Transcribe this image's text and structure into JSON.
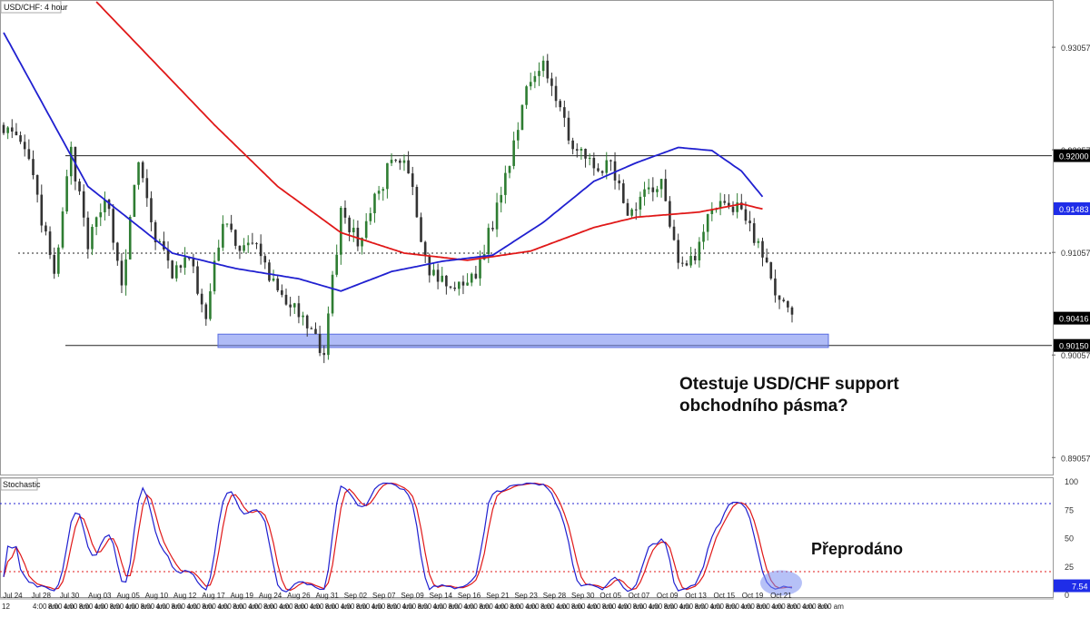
{
  "chart_data": [
    {
      "type": "candlestick",
      "title": "USD/CHF: 4 hour",
      "ylim": [
        0.889,
        0.935
      ],
      "y_ticks": [
        "0.93057",
        "0.92057",
        "0.91057",
        "0.90057",
        "0.89057"
      ],
      "x_ticks": [
        "Jul 24",
        "Jul 28",
        "Jul 30",
        "Aug 03",
        "Aug 05",
        "Aug 10",
        "Aug 12",
        "Aug 17",
        "Aug 19",
        "Aug 24",
        "Aug 26",
        "Aug 31",
        "Sep 02",
        "Sep 07",
        "Sep 09",
        "Sep 14",
        "Sep 16",
        "Sep 21",
        "Sep 23",
        "Sep 28",
        "Sep 30",
        "Oct 05",
        "Oct 07",
        "Oct 09",
        "Oct 13",
        "Oct 15",
        "Oct 19",
        "Oct 21"
      ],
      "x_sublabels": [
        "12",
        "",
        "4:00 am",
        "8:00 am",
        "4:00 am",
        "8:00 am",
        "4:00 am",
        "8:00 am",
        "4:00 am",
        "8:00 am",
        "4:00 am",
        "8:00 am",
        "4:00 am",
        "8:00 am",
        "4:00 am",
        "8:00 am",
        "4:00 am",
        "8:00 am",
        "4:00 am",
        "8:00 am",
        "4:00 am",
        "8:00 am",
        "4:00 am",
        "8:00 am",
        "4:00 am",
        "8:00 am",
        "4:00 am",
        "8:00 am",
        "4:00 am",
        "8:00 am",
        "4:00 am",
        "8:00 am",
        "4:00 am",
        "8:00 am",
        "4:00 am",
        "8:00 am",
        "4:00 am",
        "8:00 am",
        "4:00 am",
        "8:00 am",
        "4:00 am",
        "8:00 am",
        "4:00 am",
        "8:00 am",
        "4:00 am",
        "8:00 am",
        "4:00 am",
        "8:00 am",
        "4:00 am",
        "8:00 am",
        "4:00 am",
        "8:00 am",
        "4:00 am",
        "8:00 am"
      ],
      "price_keypoints": [
        [
          0,
          0.923
        ],
        [
          6,
          0.9195
        ],
        [
          12,
          0.908
        ],
        [
          16,
          0.9205
        ],
        [
          20,
          0.911
        ],
        [
          24,
          0.9165
        ],
        [
          28,
          0.9075
        ],
        [
          32,
          0.9195
        ],
        [
          36,
          0.912
        ],
        [
          40,
          0.9085
        ],
        [
          44,
          0.91
        ],
        [
          48,
          0.904
        ],
        [
          52,
          0.914
        ],
        [
          56,
          0.911
        ],
        [
          60,
          0.911
        ],
        [
          64,
          0.9075
        ],
        [
          68,
          0.9055
        ],
        [
          72,
          0.903
        ],
        [
          76,
          0.901
        ],
        [
          80,
          0.9145
        ],
        [
          84,
          0.9115
        ],
        [
          88,
          0.9155
        ],
        [
          92,
          0.9195
        ],
        [
          96,
          0.9185
        ],
        [
          100,
          0.9095
        ],
        [
          104,
          0.9075
        ],
        [
          108,
          0.907
        ],
        [
          112,
          0.9085
        ],
        [
          116,
          0.9135
        ],
        [
          120,
          0.9195
        ],
        [
          124,
          0.927
        ],
        [
          128,
          0.9295
        ],
        [
          132,
          0.924
        ],
        [
          136,
          0.9205
        ],
        [
          140,
          0.9185
        ],
        [
          144,
          0.919
        ],
        [
          148,
          0.9145
        ],
        [
          152,
          0.9165
        ],
        [
          156,
          0.9175
        ],
        [
          160,
          0.91
        ],
        [
          164,
          0.91
        ],
        [
          168,
          0.915
        ],
        [
          172,
          0.9155
        ],
        [
          176,
          0.914
        ],
        [
          180,
          0.91
        ],
        [
          184,
          0.906
        ],
        [
          187,
          0.904
        ]
      ],
      "sma_blue": [
        [
          0,
          0.932
        ],
        [
          20,
          0.917
        ],
        [
          40,
          0.9105
        ],
        [
          55,
          0.909
        ],
        [
          70,
          0.908
        ],
        [
          80,
          0.9068
        ],
        [
          92,
          0.9087
        ],
        [
          104,
          0.9097
        ],
        [
          116,
          0.9103
        ],
        [
          128,
          0.9135
        ],
        [
          140,
          0.9175
        ],
        [
          150,
          0.9193
        ],
        [
          160,
          0.9208
        ],
        [
          168,
          0.9205
        ],
        [
          175,
          0.9185
        ],
        [
          180,
          0.916
        ]
      ],
      "sma_red": [
        [
          22,
          0.935
        ],
        [
          50,
          0.923
        ],
        [
          65,
          0.917
        ],
        [
          80,
          0.9125
        ],
        [
          95,
          0.9105
        ],
        [
          110,
          0.9098
        ],
        [
          125,
          0.9107
        ],
        [
          140,
          0.913
        ],
        [
          150,
          0.914
        ],
        [
          165,
          0.9145
        ],
        [
          175,
          0.9153
        ],
        [
          180,
          0.9148
        ]
      ],
      "h_lines": [
        {
          "value": 0.92,
          "style": "solid",
          "label": "0.92000"
        },
        {
          "value": 0.9105,
          "style": "dotted",
          "label": ""
        },
        {
          "value": 0.9015,
          "style": "solid",
          "label": "0.90150"
        }
      ],
      "support_zone": {
        "low": 0.9013,
        "high": 0.9026,
        "color": "#7a8ef0"
      },
      "price_badges": [
        {
          "label": "0.91483",
          "value": 0.91483,
          "bg": "#1f2de8",
          "fg": "#ffffff"
        },
        {
          "label": "0.90416",
          "value": 0.90416,
          "bg": "#000000",
          "fg": "#ffffff"
        },
        {
          "label": "0.90150",
          "value": 0.9015,
          "bg": "#000000",
          "fg": "#ffffff"
        },
        {
          "label": "0.92000",
          "value": 0.92,
          "bg": "#000000",
          "fg": "#ffffff"
        }
      ],
      "colors": {
        "bull": "#2e7d32",
        "bear": "#333333",
        "sma_blue": "#2020d0",
        "sma_red": "#e01818"
      }
    },
    {
      "type": "line",
      "title": "Stochastic",
      "ylim": [
        0,
        100
      ],
      "y_ticks": [
        100,
        75,
        50,
        25,
        0
      ],
      "levels": [
        80,
        20
      ],
      "current_value_label": "7.54",
      "current_value": 7.54,
      "colors": {
        "k_line": "#2020d0",
        "d_line": "#e01818",
        "level": "#2020d0",
        "level_low": "#e01818"
      }
    }
  ],
  "annotations": {
    "support_question": [
      "Otestuje USD/CHF support",
      "obchodního pásma?"
    ],
    "oversold": "Přeprodáno"
  }
}
